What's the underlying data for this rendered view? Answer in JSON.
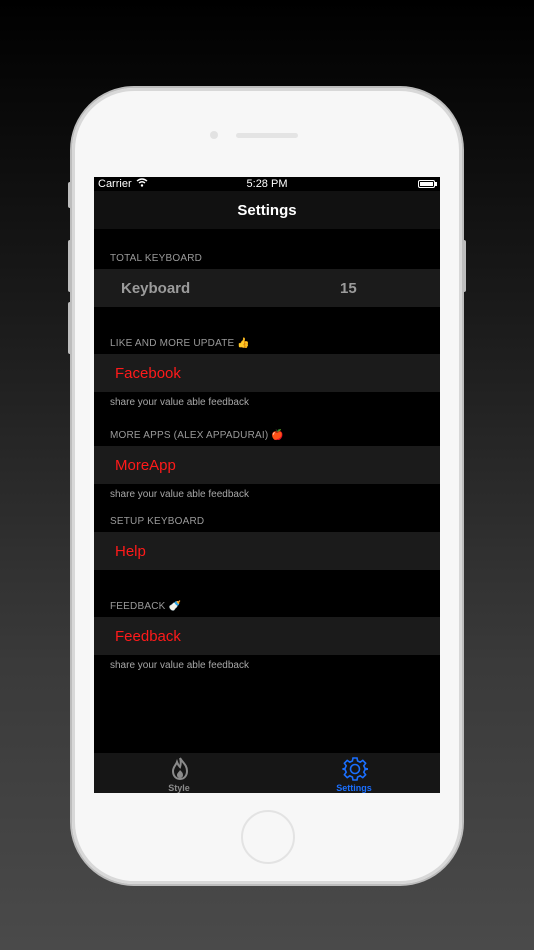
{
  "status_bar": {
    "carrier": "Carrier",
    "time": "5:28 PM"
  },
  "nav": {
    "title": "Settings"
  },
  "sections": {
    "total_keyboard": {
      "header": "TOTAL KEYBOARD",
      "label": "Keyboard",
      "count": "15"
    },
    "like_update": {
      "header": "LIKE AND MORE UPDATE 👍",
      "label": "Facebook",
      "footer": "share your value able feedback"
    },
    "more_apps": {
      "header": "MORE APPS (ALEX APPADURAI) 🍎",
      "label": "MoreApp",
      "footer": "share your value able feedback"
    },
    "setup_keyboard": {
      "header": "SETUP KEYBOARD",
      "label": "Help"
    },
    "feedback": {
      "header": "FEEDBACK 🍼",
      "label": "Feedback",
      "footer": "share your value able feedback"
    }
  },
  "tab_bar": {
    "tabs": [
      {
        "label": "Style",
        "icon": "flame-icon",
        "color": "#8a8a8a"
      },
      {
        "label": "Settings",
        "icon": "gear-icon",
        "color": "#1a6fff"
      }
    ]
  },
  "colors": {
    "accent_red": "#ff1a1a",
    "tab_active": "#1a6fff",
    "cell_bg": "#1b1b1b"
  }
}
